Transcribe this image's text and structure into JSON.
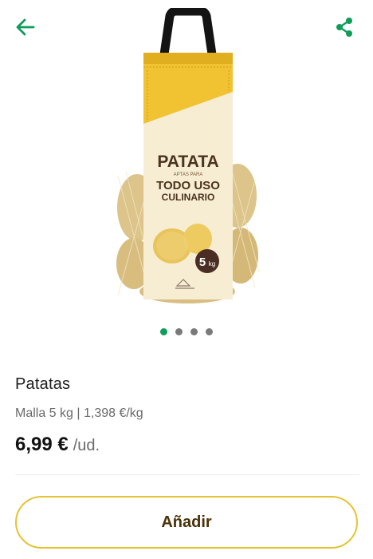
{
  "header": {
    "back_icon": "arrow-left-icon",
    "share_icon": "share-icon",
    "accent_color": "#0f9d58"
  },
  "product": {
    "image": {
      "bag_brand": "PATATA",
      "bag_subtitle": "APTAS PARA",
      "bag_line1": "TODO USO",
      "bag_line2": "CULINARIO",
      "bag_weight": "5",
      "bag_weight_unit": "kg"
    },
    "carousel": {
      "count": 4,
      "active_index": 0
    },
    "name": "Patatas",
    "description": "Malla 5 kg | 1,398 €/kg",
    "price": "6,99 €",
    "price_unit": "/ud."
  },
  "actions": {
    "add_label": "Añadir",
    "add_border_color": "#e6c334"
  }
}
